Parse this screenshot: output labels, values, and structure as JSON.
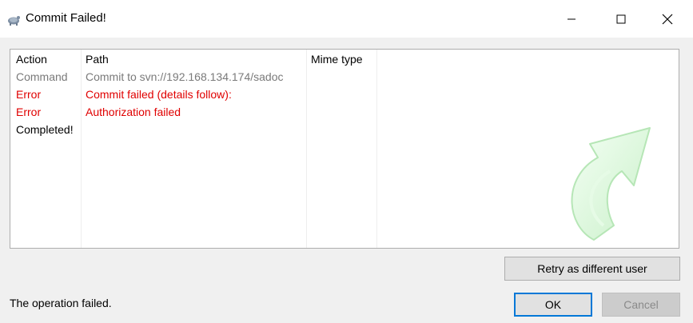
{
  "window": {
    "title": "Commit Failed!",
    "icon": "tortoise-svn-icon",
    "controls": {
      "minimize_icon": "minimize-icon",
      "maximize_icon": "maximize-icon",
      "close_icon": "close-icon"
    }
  },
  "list": {
    "columns": [
      "Action",
      "Path",
      "Mime type"
    ],
    "rows": [
      {
        "action": "Command",
        "path": "Commit to svn://192.168.134.174/sadoc",
        "mime": "",
        "color": "#7a7a7a"
      },
      {
        "action": "Error",
        "path": "Commit failed (details follow):",
        "mime": "",
        "color": "#e00000"
      },
      {
        "action": "Error",
        "path": "Authorization failed",
        "mime": "",
        "color": "#e00000"
      },
      {
        "action": "Completed!",
        "path": "",
        "mime": "",
        "color": "#000000"
      }
    ],
    "decoration_icon": "green-curved-arrow-icon"
  },
  "buttons": {
    "retry": "Retry as different user",
    "ok": "OK",
    "cancel": "Cancel"
  },
  "status_text": "The operation failed.",
  "colors": {
    "error": "#e00000",
    "command": "#7a7a7a",
    "focus_border": "#0078d7"
  }
}
